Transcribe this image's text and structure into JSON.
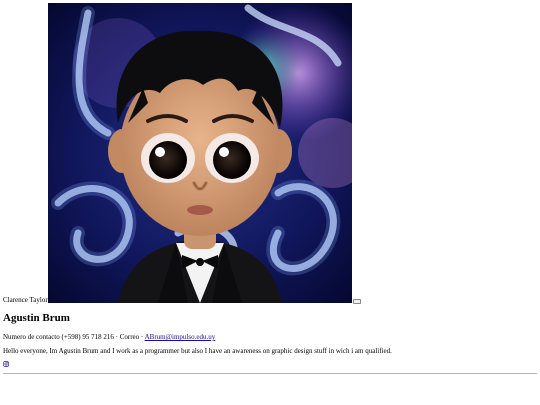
{
  "profile": {
    "image_caption": "Clarence Taylor",
    "name": "Agustin Brum",
    "contact_prefix": "Numero de contacto (+598) 95 718 216 · Correo ·",
    "email": "ABrum@impulso.edu.uy",
    "bio": "Hello everyone, Im Agustin Brum and I work as a programmer but also I have an awareness on graphic design stuff in wich i am qualified.",
    "social_icon": "instagram-icon"
  },
  "colors": {
    "link": "#1a0dab",
    "portrait_bg": "#0a0f3a"
  }
}
